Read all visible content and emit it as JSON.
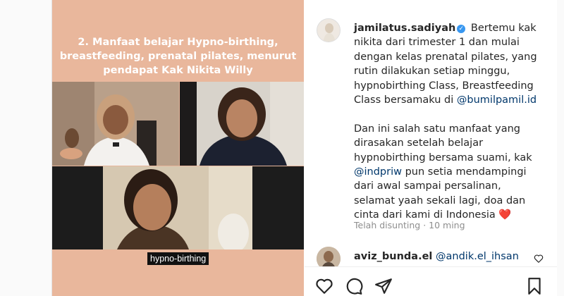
{
  "media": {
    "title": "2. Manfaat belajar Hypno-birthing, breastfeeding, prenatal pilates, menurut pendapat Kak Nikita Willy",
    "subtitle": "hypno-birthing"
  },
  "post": {
    "username": "jamilatus.sadiyah",
    "text_part1": "Bertemu kak nikita dari trimester 1 dan mulai dengan kelas prenatal pilates, yang rutin dilakukan setiap minggu, hypnobirthing Class, Breastfeeding Class bersamaku di ",
    "mention1": "@bumilpamil.id",
    "text_part2": "Dan ini salah satu manfaat yang dirasakan setelah belajar hypnobirthing bersama suami, kak ",
    "mention2": "@indpriw",
    "text_part3": " pun setia mendampingi dari awal sampai persalinan, selamat yaah sekali lagi, doa dan cinta dari kami di Indonesia ",
    "heart_emoji": "❤️",
    "meta": "Telah disunting · 10 ming"
  },
  "comment": {
    "username": "aviz_bunda.el",
    "mention": "@andik.el_ihsan"
  },
  "icons": {
    "verified": "verified-badge-icon",
    "like": "heart-icon",
    "comment": "comment-bubble-icon",
    "share": "paper-plane-icon",
    "save": "bookmark-icon"
  },
  "colors": {
    "media_bg": "#e9b79c",
    "mention": "#00376b",
    "verified": "#3897f0",
    "meta": "#8e8e8e"
  }
}
